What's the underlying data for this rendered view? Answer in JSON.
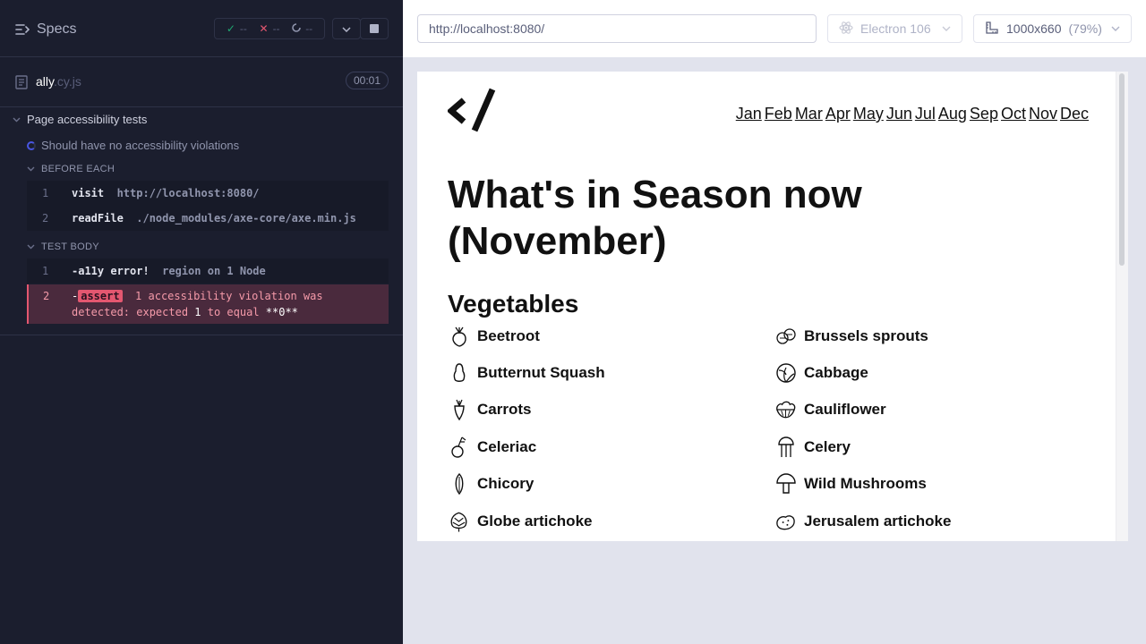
{
  "reporter": {
    "specs_label": "Specs",
    "stats": {
      "passed": "--",
      "failed": "--",
      "pending": "--"
    },
    "file": {
      "base": "ally",
      "ext": ".cy.js",
      "duration": "00:01"
    },
    "suite_title": "Page accessibility tests",
    "test_title": "Should have no accessibility violations",
    "before_each": {
      "title": "BEFORE EACH",
      "commands": [
        {
          "num": "1",
          "name": "visit",
          "msg": "http://localhost:8080/"
        },
        {
          "num": "2",
          "name": "readFile",
          "msg": "./node_modules/axe-core/axe.min.js"
        }
      ]
    },
    "test_body": {
      "title": "TEST BODY",
      "commands": [
        {
          "num": "1",
          "name": "-a11y error!",
          "msg": "region on 1 Node"
        }
      ],
      "error": {
        "num": "2",
        "dash": "-",
        "tag": "assert",
        "line1": "1 accessibility violation was",
        "line2_a": "detected: expected",
        "line2_b": "1",
        "line2_c": "to equal",
        "line2_d": "**0**"
      }
    }
  },
  "aut": {
    "url": "http://localhost:8080/",
    "browser": "Electron 106",
    "viewport": "1000x660",
    "scale": "(79%)"
  },
  "site": {
    "months": [
      "Jan",
      "Feb",
      "Mar",
      "Apr",
      "May",
      "Jun",
      "Jul",
      "Aug",
      "Sep",
      "Oct",
      "Nov",
      "Dec"
    ],
    "heading_line1": "What's in Season now",
    "heading_line2": "(November)",
    "section": "Vegetables",
    "vegetables": [
      {
        "name": "Beetroot",
        "icon": "beetroot-icon"
      },
      {
        "name": "Brussels sprouts",
        "icon": "brussels-sprouts-icon"
      },
      {
        "name": "Butternut Squash",
        "icon": "butternut-squash-icon"
      },
      {
        "name": "Cabbage",
        "icon": "cabbage-icon"
      },
      {
        "name": "Carrots",
        "icon": "carrot-icon"
      },
      {
        "name": "Cauliflower",
        "icon": "cauliflower-icon"
      },
      {
        "name": "Celeriac",
        "icon": "celeriac-icon"
      },
      {
        "name": "Celery",
        "icon": "celery-icon"
      },
      {
        "name": "Chicory",
        "icon": "chicory-icon"
      },
      {
        "name": "Wild Mushrooms",
        "icon": "mushroom-icon"
      },
      {
        "name": "Globe artichoke",
        "icon": "artichoke-icon"
      },
      {
        "name": "Jerusalem artichoke",
        "icon": "jerusalem-artichoke-icon"
      }
    ]
  }
}
